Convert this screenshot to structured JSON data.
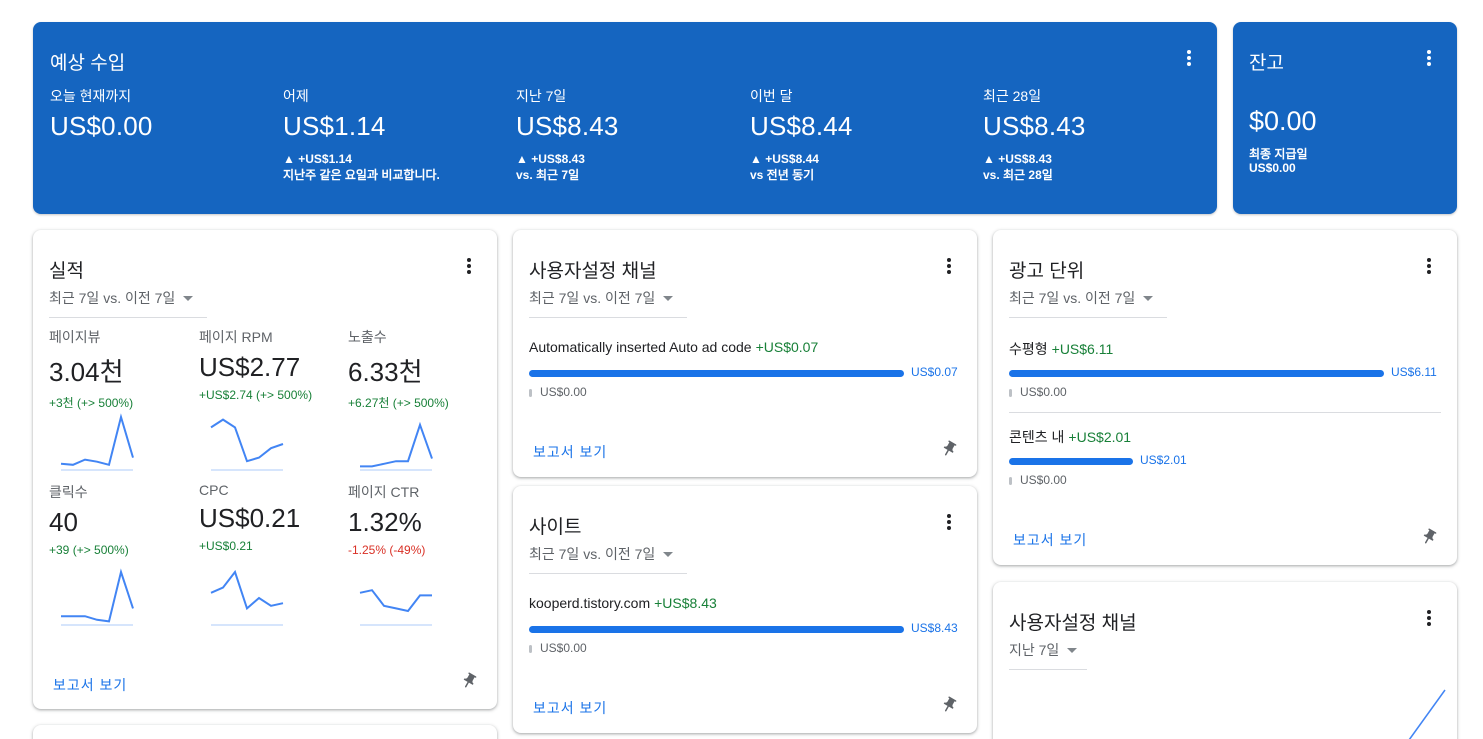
{
  "estimated_earnings": {
    "title": "예상 수입",
    "metrics": [
      {
        "label": "오늘 현재까지",
        "value": "US$0.00",
        "delta": "",
        "compare": ""
      },
      {
        "label": "어제",
        "value": "US$1.14",
        "delta": "▲ +US$1.14",
        "compare": "지난주 같은 요일과 비교합니다."
      },
      {
        "label": "지난 7일",
        "value": "US$8.43",
        "delta": "▲ +US$8.43",
        "compare": "vs. 최근 7일"
      },
      {
        "label": "이번 달",
        "value": "US$8.44",
        "delta": "▲ +US$8.44",
        "compare": "vs 전년 동기"
      },
      {
        "label": "최근 28일",
        "value": "US$8.43",
        "delta": "▲ +US$8.43",
        "compare": "vs. 최근 28일"
      }
    ]
  },
  "balance": {
    "title": "잔고",
    "value": "$0.00",
    "last_payment_label": "최종 지급일",
    "last_payment_value": "US$0.00"
  },
  "performance": {
    "title": "실적",
    "range": "최근 7일 vs. 이전 7일",
    "metrics": [
      {
        "label": "페이지뷰",
        "value": "3.04천",
        "delta": "+3천 (+> 500%)",
        "trend": "up",
        "spark": [
          0.1,
          0.08,
          0.18,
          0.14,
          0.08,
          1.0,
          0.22
        ]
      },
      {
        "label": "페이지 RPM",
        "value": "US$2.77",
        "delta": "+US$2.74 (+> 500%)",
        "trend": "up",
        "spark": [
          0.8,
          0.95,
          0.8,
          0.15,
          0.22,
          0.4,
          0.48
        ]
      },
      {
        "label": "노출수",
        "value": "6.33천",
        "delta": "+6.27천 (+> 500%)",
        "trend": "up",
        "spark": [
          0.05,
          0.05,
          0.1,
          0.15,
          0.15,
          0.85,
          0.2
        ]
      },
      {
        "label": "클릭수",
        "value": "40",
        "delta": "+39 (+> 500%)",
        "trend": "up",
        "spark": [
          0.15,
          0.15,
          0.15,
          0.08,
          0.05,
          1.0,
          0.3
        ]
      },
      {
        "label": "CPC",
        "value": "US$0.21",
        "delta": "+US$0.21",
        "trend": "up",
        "spark": [
          0.6,
          0.7,
          1.0,
          0.3,
          0.5,
          0.35,
          0.4
        ]
      },
      {
        "label": "페이지 CTR",
        "value": "1.32%",
        "delta": "-1.25% (-49%)",
        "trend": "down",
        "spark": [
          0.6,
          0.65,
          0.35,
          0.3,
          0.25,
          0.55,
          0.55
        ]
      }
    ],
    "report_link": "보고서 보기"
  },
  "custom_channels": {
    "title": "사용자설정 채널",
    "range": "최근 7일 vs. 이전 7일",
    "rows": [
      {
        "name": "Automatically inserted Auto ad code",
        "delta": "+US$0.07",
        "value": "US$0.07",
        "fill": 1.0,
        "zero": "US$0.00"
      }
    ],
    "report_link": "보고서 보기"
  },
  "sites": {
    "title": "사이트",
    "range": "최근 7일 vs. 이전 7일",
    "rows": [
      {
        "name": "kooperd.tistory.com",
        "delta": "+US$8.43",
        "value": "US$8.43",
        "fill": 1.0,
        "zero": "US$0.00"
      }
    ],
    "report_link": "보고서 보기"
  },
  "ad_units": {
    "title": "광고 단위",
    "range": "최근 7일 vs. 이전 7일",
    "rows": [
      {
        "name": "수평형",
        "delta": "+US$6.11",
        "value": "US$6.11",
        "fill": 1.0,
        "zero": "US$0.00"
      },
      {
        "name": "콘텐츠 내",
        "delta": "+US$2.01",
        "value": "US$2.01",
        "fill": 0.33,
        "zero": "US$0.00"
      }
    ],
    "report_link": "보고서 보기"
  },
  "custom_channels_2": {
    "title": "사용자설정 채널",
    "range": "지난 7일"
  },
  "colors": {
    "brand_blue": "#1565c0",
    "accent": "#1a73e8",
    "positive": "#188038",
    "negative": "#d93025"
  }
}
